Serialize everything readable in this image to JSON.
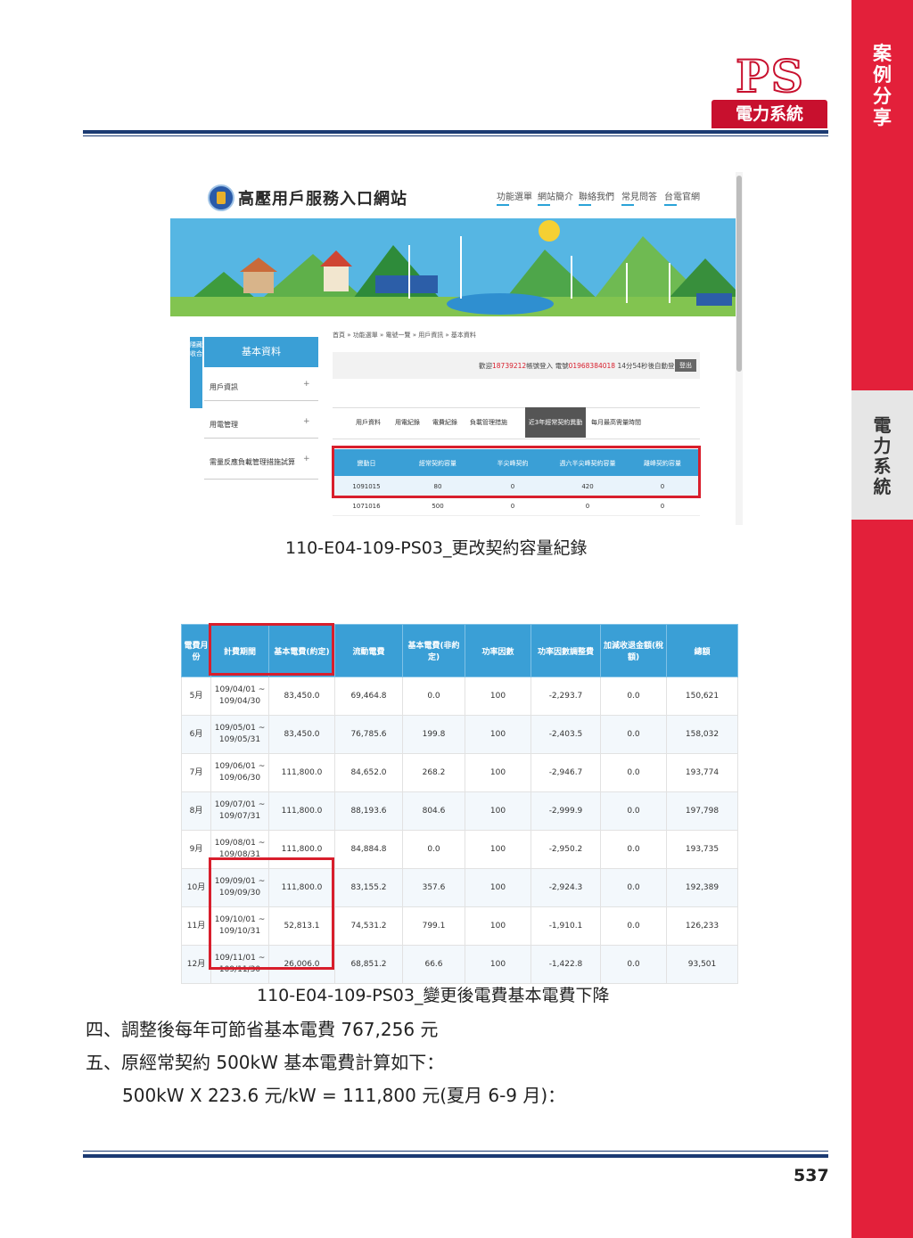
{
  "side": {
    "top_label": [
      "案",
      "例",
      "分",
      "享"
    ],
    "mid_label": [
      "電",
      "力",
      "系",
      "統"
    ]
  },
  "header": {
    "logo": "PS",
    "tag": "電力系統"
  },
  "shot1": {
    "site_title": "高壓用戶服務入口網站",
    "nav": [
      "功能選單",
      "網站簡介",
      "聯絡我們",
      "常見問答",
      "台電官網"
    ],
    "sidebar_head": "基本資料",
    "sidebar_toggle": "隱藏收合",
    "menu": [
      "用戶資訊",
      "用電管理",
      "需量反應負載管理措施試算"
    ],
    "breadcrumb": "首頁 » 功能選單 » 電號一覽 » 用戶資訊 » 基本資料",
    "welcome_prefix": "歡迎",
    "welcome_id": "18739212",
    "welcome_mid": "帳號登入 電號",
    "welcome_meter": "01968384018",
    "welcome_time": "14分54秒",
    "welcome_suffix": "後自動登出",
    "logout": "登出",
    "tabs": [
      "用戶資料",
      "用電紀錄",
      "電費紀錄",
      "負載管理措施",
      "近3年經常契約異動",
      "每月最高需量時間"
    ],
    "table_headers": [
      "變動日",
      "經常契約容量",
      "半尖峰契約",
      "週六半尖峰契約容量",
      "離峰契約容量"
    ],
    "rows": [
      [
        "1091015",
        "80",
        "0",
        "420",
        "0"
      ],
      [
        "1071016",
        "500",
        "0",
        "0",
        "0"
      ]
    ]
  },
  "caption1": "110-E04-109-PS03_更改契約容量紀錄",
  "table2": {
    "headers": [
      "電費月份",
      "計費期間",
      "基本電費(約定)",
      "流動電費",
      "基本電費(非約定)",
      "功率因數",
      "功率因數調整費",
      "加減收退金額(稅額)",
      "總額"
    ],
    "rows": [
      [
        "5月",
        "109/04/01 ~",
        "109/04/30",
        "83,450.0",
        "69,464.8",
        "0.0",
        "100",
        "-2,293.7",
        "0.0",
        "150,621"
      ],
      [
        "6月",
        "109/05/01 ~",
        "109/05/31",
        "83,450.0",
        "76,785.6",
        "199.8",
        "100",
        "-2,403.5",
        "0.0",
        "158,032"
      ],
      [
        "7月",
        "109/06/01 ~",
        "109/06/30",
        "111,800.0",
        "84,652.0",
        "268.2",
        "100",
        "-2,946.7",
        "0.0",
        "193,774"
      ],
      [
        "8月",
        "109/07/01 ~",
        "109/07/31",
        "111,800.0",
        "88,193.6",
        "804.6",
        "100",
        "-2,999.9",
        "0.0",
        "197,798"
      ],
      [
        "9月",
        "109/08/01 ~",
        "109/08/31",
        "111,800.0",
        "84,884.8",
        "0.0",
        "100",
        "-2,950.2",
        "0.0",
        "193,735"
      ],
      [
        "10月",
        "109/09/01 ~",
        "109/09/30",
        "111,800.0",
        "83,155.2",
        "357.6",
        "100",
        "-2,924.3",
        "0.0",
        "192,389"
      ],
      [
        "11月",
        "109/10/01 ~",
        "109/10/31",
        "52,813.1",
        "74,531.2",
        "799.1",
        "100",
        "-1,910.1",
        "0.0",
        "126,233"
      ],
      [
        "12月",
        "109/11/01 ~",
        "109/11/30",
        "26,006.0",
        "68,851.2",
        "66.6",
        "100",
        "-1,422.8",
        "0.0",
        "93,501"
      ]
    ]
  },
  "caption2": "110-E04-109-PS03_變更後電費基本電費下降",
  "body": {
    "line4": "四、調整後每年可節省基本電費  767,256 元",
    "line5": "五、原經常契約 500kW 基本電費計算如下：",
    "line6": "500kW X 223.6 元/kW = 111,800 元(夏月 6-9 月)："
  },
  "page_number": "537"
}
